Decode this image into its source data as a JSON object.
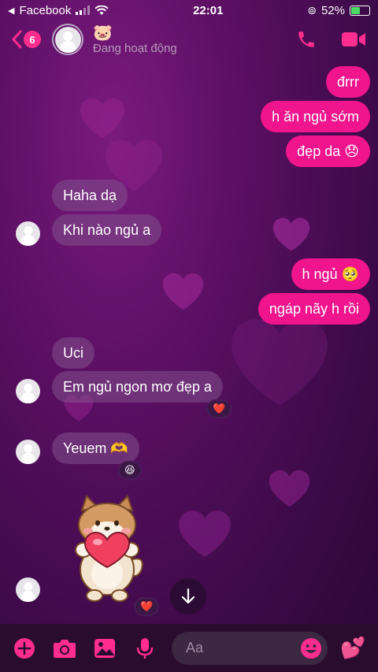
{
  "status_bar": {
    "back_app": "Facebook",
    "time": "22:01",
    "battery": "52%",
    "battery_level": 0.52
  },
  "header": {
    "unread_count": "6",
    "contact_emoji": "🐷",
    "status": "Đang hoạt động"
  },
  "messages": [
    {
      "side": "out",
      "text": "đrrr"
    },
    {
      "side": "out",
      "text": "h ăn ngủ sớm"
    },
    {
      "side": "out",
      "text": "đẹp da 😞"
    },
    {
      "side": "in",
      "text": "Haha dạ"
    },
    {
      "side": "in",
      "text": "Khi nào ngủ a"
    },
    {
      "side": "out",
      "text": "h ngủ 🥺"
    },
    {
      "side": "out",
      "text": "ngáp nãy h rồi"
    },
    {
      "side": "in",
      "text": "Uci"
    },
    {
      "side": "in",
      "text": "Em ngủ ngon mơ đẹp a",
      "reaction": "❤️"
    },
    {
      "side": "in",
      "text": "Yeuem 🫶",
      "reaction": "😆"
    }
  ],
  "sticker": {
    "name": "shiba-holding-heart",
    "reaction": "❤️"
  },
  "composer": {
    "placeholder": "Aa",
    "send_quick": "💕"
  },
  "colors": {
    "accent": "#ff2d8f",
    "outgoing_bubble": "#f0148d",
    "background": "#5a0f62"
  }
}
